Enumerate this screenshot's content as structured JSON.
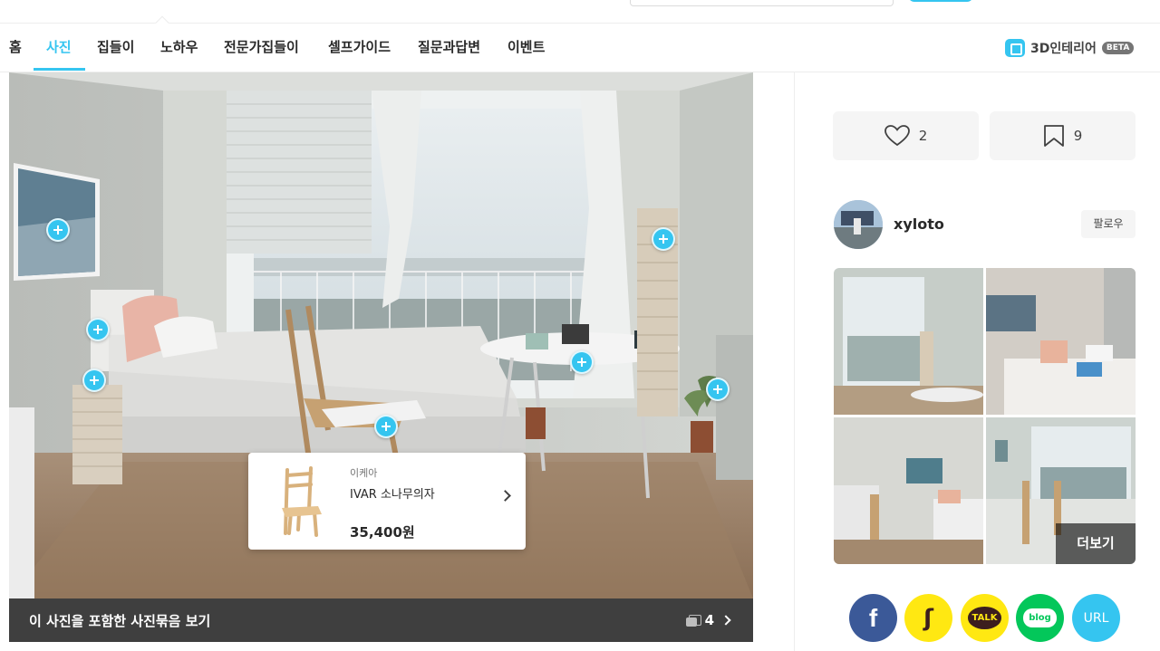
{
  "nav": {
    "items": [
      "홈",
      "사진",
      "집들이",
      "노하우",
      "전문가집들이",
      "셀프가이드",
      "질문과답변",
      "이벤트"
    ],
    "active_index": 1,
    "interior3d_label": "3D인테리어",
    "beta_badge": "BETA"
  },
  "photo": {
    "product_tooltip": {
      "brand": "이케아",
      "name": "IVAR 소나무의자",
      "price": "35,400원"
    },
    "collection_label": "이 사진을 포함한 사진묶음 보기",
    "collection_count": "4"
  },
  "sidebar": {
    "like_count": "2",
    "scrap_count": "9",
    "username": "xyloto",
    "follow_label": "팔로우",
    "more_label": "더보기",
    "share": {
      "facebook": "f",
      "story": "ʃ",
      "kakaotalk": "TALK",
      "blog": "blog",
      "url": "URL"
    }
  },
  "colors": {
    "accent": "#35c5f0",
    "facebook": "#3b5998",
    "kakao": "#ffe812",
    "naver": "#03c75a"
  }
}
